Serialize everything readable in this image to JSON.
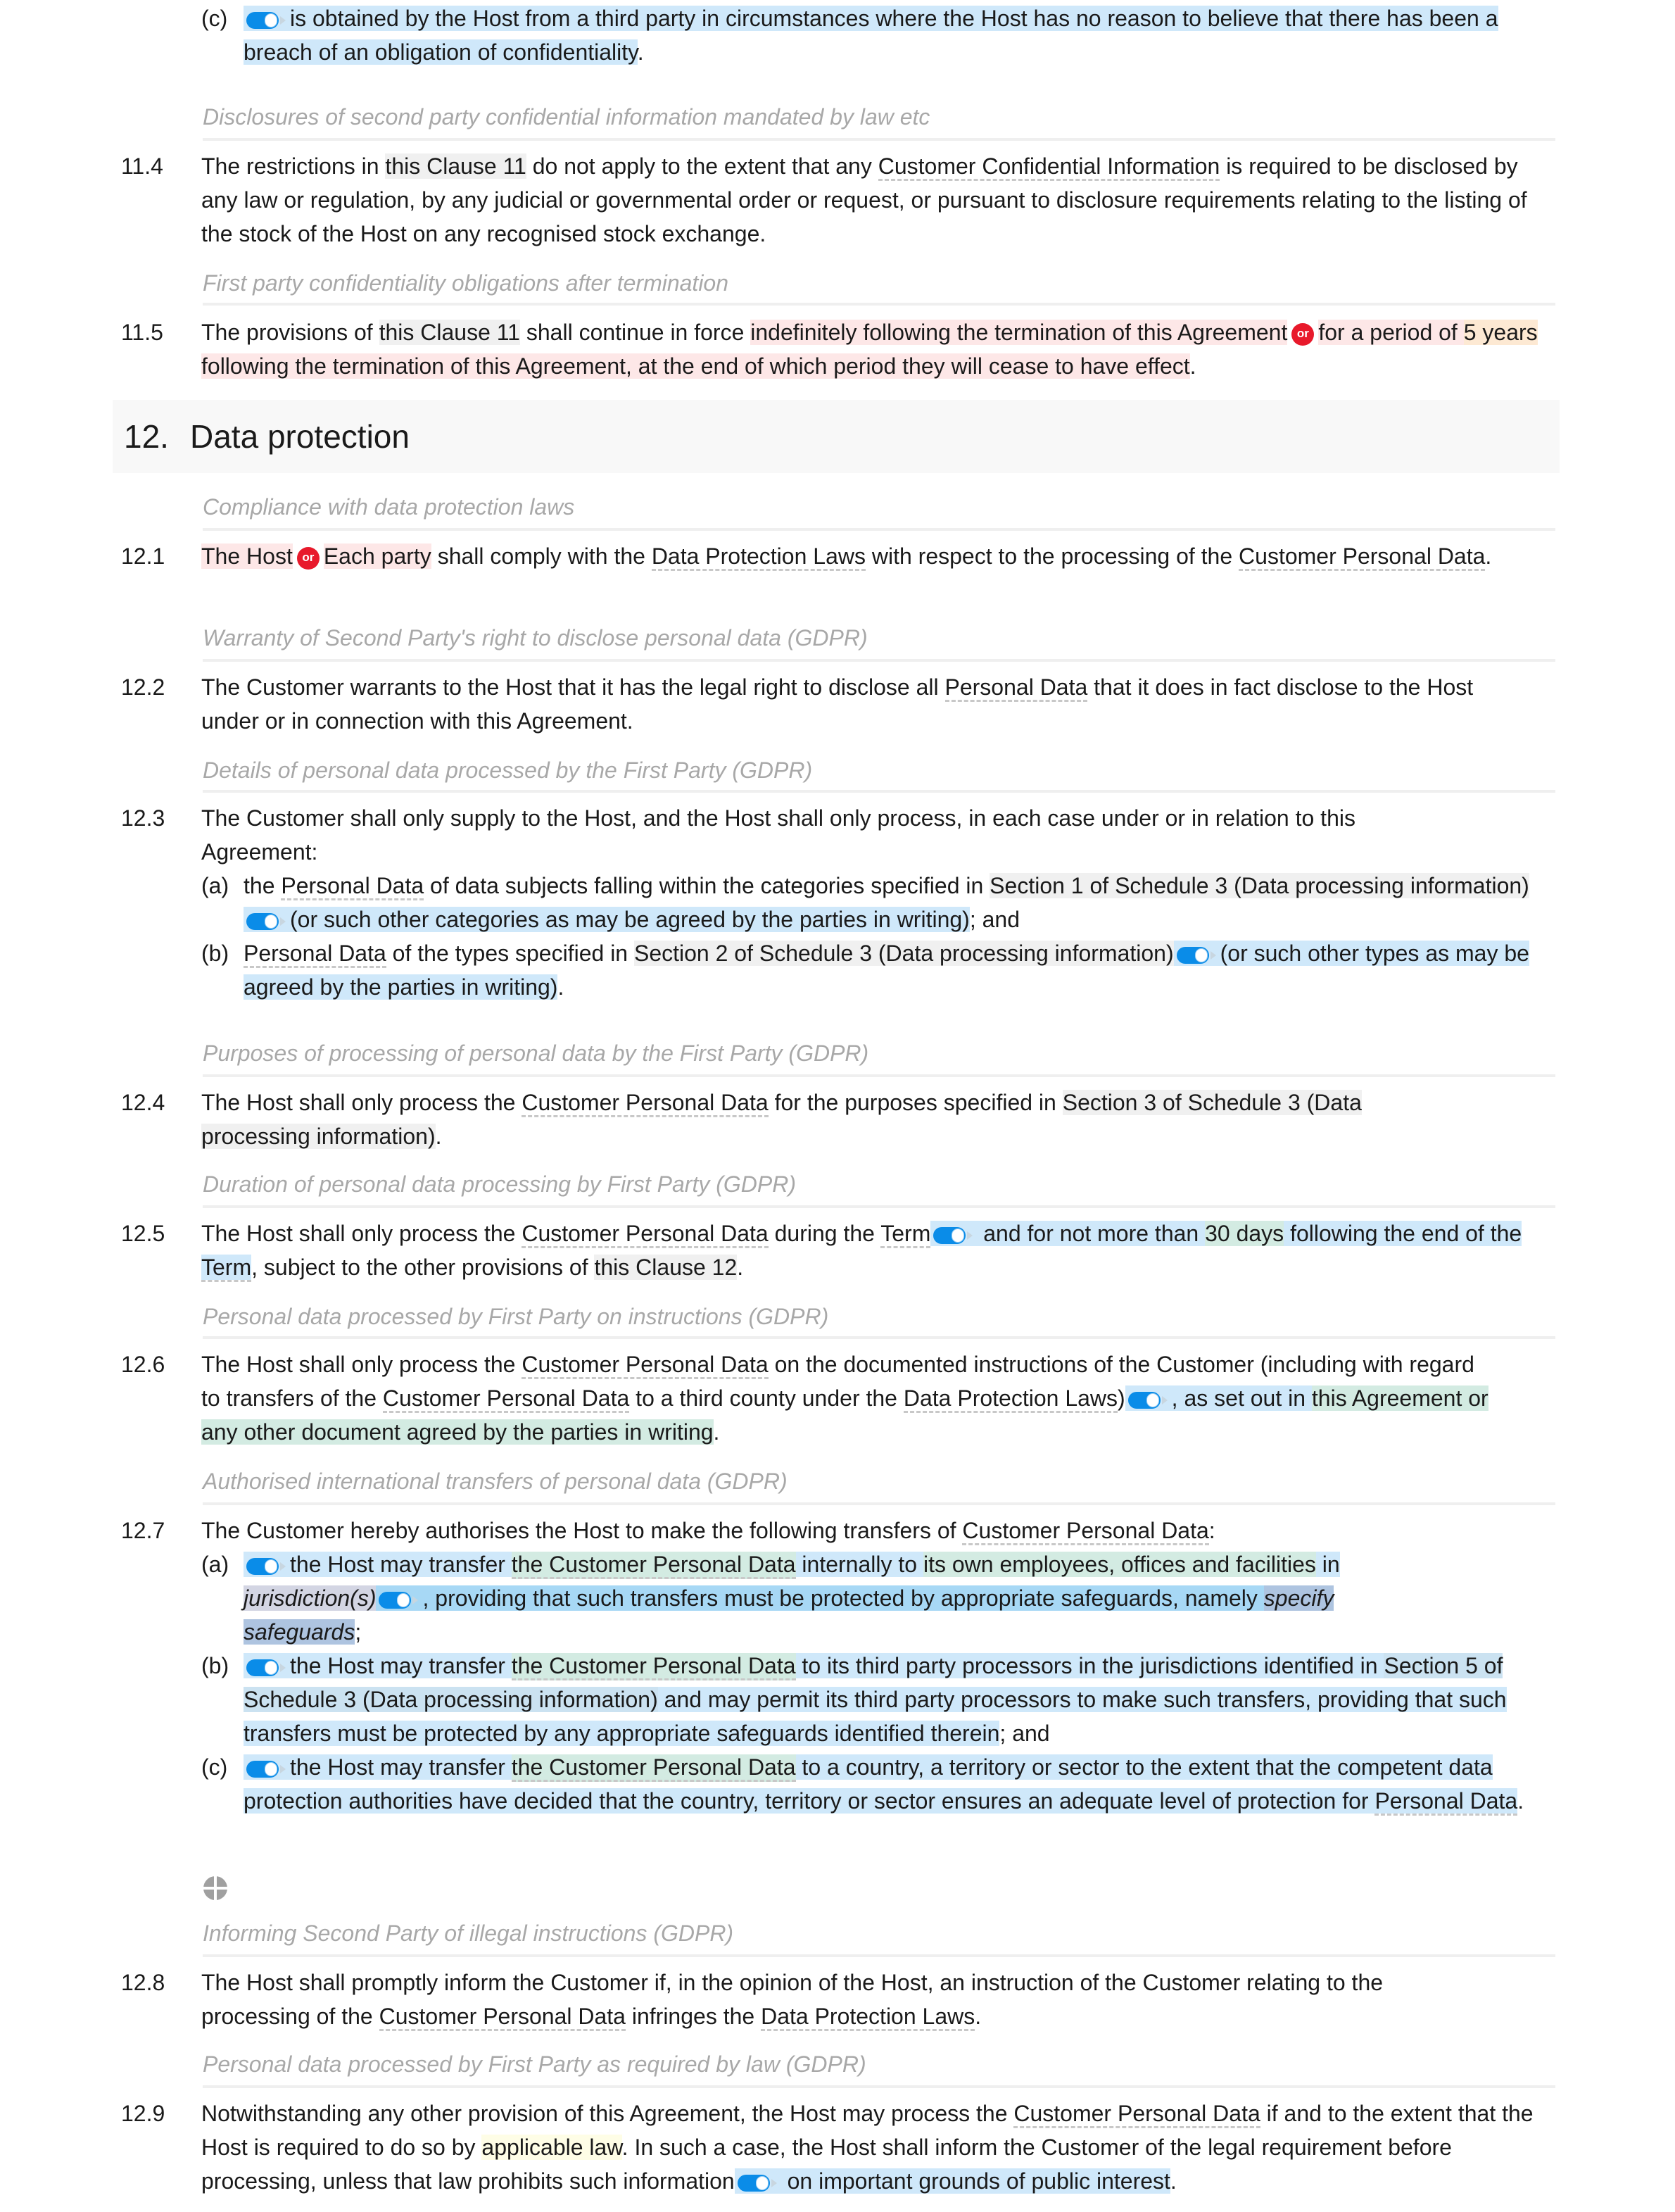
{
  "clause_11": {
    "item_c": {
      "label": "(c)",
      "text": "is obtained by the Host from a third party in circumstances where the Host has no reason to believe that there has been a breach of an obligation of confidentiality",
      "end": "."
    },
    "heading_disclosures": "Disclosures of second party confidential information mandated by law etc",
    "c11_4": {
      "num": "11.4",
      "p1": "The restrictions in ",
      "ref": "this Clause 11",
      "p2": " do not apply to the extent that any ",
      "def": "Customer Confidential Information",
      "p3": " is required to be disclosed by any law or regulation, by any judicial or governmental order or request, or pursuant to disclosure requirements relating to the listing of the stock of the Host on any recognised stock exchange."
    },
    "heading_after_termination": "First party confidentiality obligations after termination",
    "c11_5": {
      "num": "11.5",
      "p1": "The provisions of ",
      "ref": "this Clause 11",
      "p2": " shall continue in force ",
      "opt1": "indefinitely following the termination of this Agreement",
      "or": "or",
      "opt2a": "for a period of ",
      "years": "5 years",
      "opt2b": " following the termination of this Agreement, at the end of which period they will cease to have effect",
      "end": "."
    }
  },
  "section_12": {
    "number": "12.",
    "title": "Data protection",
    "clauses": {
      "c1": {
        "heading": "Compliance with data protection laws",
        "num": "12.1",
        "opt1": "The Host",
        "or": "or",
        "opt2": "Each party",
        "p1": " shall comply with the ",
        "def1": "Data Protection Laws",
        "p2": " with respect to the processing of the ",
        "def2": "Customer Personal Data",
        "end": "."
      },
      "c2": {
        "heading": "Warranty of Second Party's right to disclose personal data (GDPR)",
        "num": "12.2",
        "p1": "The Customer warrants to the Host that it has the legal right to disclose all ",
        "def": "Personal Data",
        "p2": " that it does in fact disclose to the Host under or in connection with this Agreement."
      },
      "c3": {
        "heading": "Details of personal data processed by the First Party (GDPR)",
        "num": "12.3",
        "intro": "The Customer shall only supply to the Host, and the Host shall only process, in each case under or in relation to this Agreement:",
        "a": {
          "label": "(a)",
          "p1": "the ",
          "def": "Personal Data",
          "p2": " of data subjects falling within the categories specified in ",
          "ref": "Section 1 of Schedule 3 (Data processing information)",
          "opt": "(or such other categories as may be agreed by the parties in writing)",
          "end": "; and"
        },
        "b": {
          "label": "(b)",
          "def": "Personal Data",
          "p1": " of the types specified in ",
          "ref": "Section 2 of Schedule 3 (Data processing information)",
          "opt": "(or such other types as may be agreed by the parties in writing)",
          "end": "."
        }
      },
      "c4": {
        "heading": "Purposes of processing of personal data by the First Party (GDPR)",
        "num": "12.4",
        "p1": "The Host shall only process the ",
        "def": "Customer Personal Data",
        "p2": " for the purposes specified in ",
        "ref": "Section 3 of Schedule 3 (Data processing information)",
        "end": "."
      },
      "c5": {
        "heading": "Duration of personal data processing by First Party (GDPR)",
        "num": "12.5",
        "p1": "The Host shall only process the ",
        "def": "Customer Personal Data",
        "p2": " during the ",
        "def2": "Term",
        "opt_a": " and for not more than ",
        "days": "30 days",
        "opt_b": " following the end of the ",
        "def3": "Term",
        "p3": ", subject to the other provisions of ",
        "ref": "this Clause 12",
        "end": "."
      },
      "c6": {
        "heading": "Personal data processed by First Party on instructions (GDPR)",
        "num": "12.6",
        "p1": "The Host shall only process the ",
        "def": "Customer Personal Data",
        "p2": " on the documented instructions of the Customer (including with regard to transfers of the ",
        "def2": "Customer Personal Data",
        "p3": " to a third county under the ",
        "def3": "Data Protection Laws",
        "p4": ")",
        "opt_a": ", as set out in ",
        "opt_b": "this Agreement or any other document agreed by the parties in writing",
        "end": "."
      },
      "c7": {
        "heading": "Authorised international transfers of personal data (GDPR)",
        "num": "12.7",
        "p1": "The Customer hereby authorises the Host to make the following transfers of ",
        "def": "Customer Personal Data",
        "end": ":",
        "a": {
          "label": "(a)",
          "p1": "the Host may transfer ",
          "cpd": "the Customer Personal Data",
          "p2": " internally to ",
          "green": "its own employees, offices and facilities",
          "p3": " in ",
          "jur": "jurisdiction(s)",
          "p4": ", providing that such transfers must be protected by appropriate safeguards, namely ",
          "spec": "specify safeguards",
          "end": ";"
        },
        "b": {
          "label": "(b)",
          "p1": "the Host may transfer ",
          "cpd": "the Customer Personal Data",
          "p2": " to its third party processors in the jurisdictions identified in ",
          "ref": "Section 5 of Schedule 3 (Data processing information)",
          "p3": " and may permit its third party processors to make such transfers, providing that such transfers must be protected by any appropriate safeguards identified therein",
          "end": "; and"
        },
        "c": {
          "label": "(c)",
          "p1": "the Host may transfer ",
          "cpd": "the Customer Personal Data",
          "p2": " to a country, a territory or sector to the extent that the competent data protection authorities have decided that the country, territory or sector ensures an adequate level of protection for ",
          "def": "Personal Data",
          "end": "."
        }
      },
      "c8": {
        "heading": "Informing Second Party of illegal instructions (GDPR)",
        "num": "12.8",
        "p1": "The Host shall promptly inform the Customer if, in the opinion of the Host, an instruction of the Customer relating to the processing of the ",
        "def": "Customer Personal Data",
        "p2": " infringes the ",
        "def2": "Data Protection Laws",
        "end": "."
      },
      "c9": {
        "heading": "Personal data processed by First Party as required by law (GDPR)",
        "num": "12.9",
        "p1": "Notwithstanding any other provision of this Agreement, the Host may process the ",
        "def": "Customer Personal Data",
        "p2": " if and to the extent that the Host is required to do so by ",
        "law": "applicable law",
        "p3": ". In such a case, the Host shall inform the Customer of the legal requirement before processing, unless that law prohibits such information",
        "opt": " on important grounds of public interest",
        "end": "."
      }
    }
  },
  "icons": {
    "toggle": "toggle-on-icon",
    "or": "or-badge-icon",
    "add": "add-clause-icon"
  },
  "colors": {
    "toggle": "#0a8ce8",
    "or_badge": "#e8192b",
    "optional_highlight": "#cfe8fa",
    "alternative_highlight": "#fde7e7",
    "heading_text": "#a8a8a8"
  }
}
